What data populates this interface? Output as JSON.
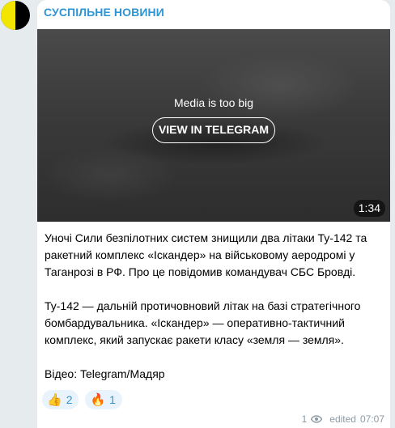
{
  "channel": {
    "name": "СУСПІЛЬНЕ НОВИНИ"
  },
  "media": {
    "note": "Media is too big",
    "button_label": "VIEW IN TELEGRAM",
    "duration": "1:34"
  },
  "message": {
    "paragraph_1": "Уночі Сили безпілотних систем знищили два літаки Ту-142 та ракетний комплекс «Іскандер» на військовому аеродромі у Таганрозі в РФ. Про це повідомив командувач СБС Бровді.",
    "paragraph_2": "Ту-142 — дальній протичовновий літак на базі стратегічного бомбардувальника. «Іскандер» — оперативно-тактичний комплекс, який запускає ракети класу «земля — земля».",
    "paragraph_3": "Відео: Telegram/Мадяр"
  },
  "reactions": [
    {
      "emoji": "👍",
      "count": "2"
    },
    {
      "emoji": "🔥",
      "count": "1"
    }
  ],
  "footer": {
    "views": "1",
    "edited_label": "edited",
    "time": "07:07"
  },
  "colors": {
    "accent": "#2e95d4",
    "background": "#e6ebee",
    "bubble": "#ffffff",
    "meta": "#8d9aa3",
    "reaction_bg": "#e9f3fb",
    "avatar_yellow": "#f2e600",
    "avatar_black": "#000000"
  },
  "icons": {
    "avatar": "channel-avatar",
    "views": "eye-icon"
  }
}
